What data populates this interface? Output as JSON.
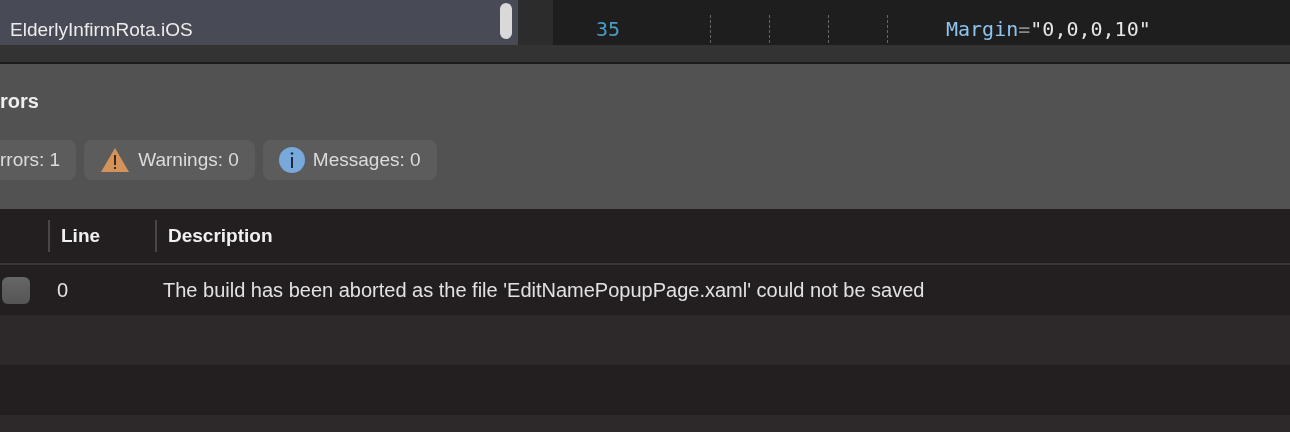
{
  "solution_tree": {
    "item": "ElderlyInfirmRota.iOS"
  },
  "editor": {
    "lines": [
      {
        "number": "35",
        "attribute": "Margin",
        "equals": "=",
        "value": "\"0,0,0,10\""
      }
    ]
  },
  "errors_panel": {
    "title": "rors",
    "filters": [
      {
        "kind": "error",
        "label": "rrors: 1"
      },
      {
        "kind": "warning",
        "label": "Warnings: 0"
      },
      {
        "kind": "info",
        "label": "Messages: 0"
      }
    ],
    "columns": [
      "Line",
      "Description"
    ],
    "rows": [
      {
        "checked": false,
        "line": "0",
        "description": "The build has been aborted as the file 'EditNamePopupPage.xaml' could not be saved"
      }
    ]
  }
}
